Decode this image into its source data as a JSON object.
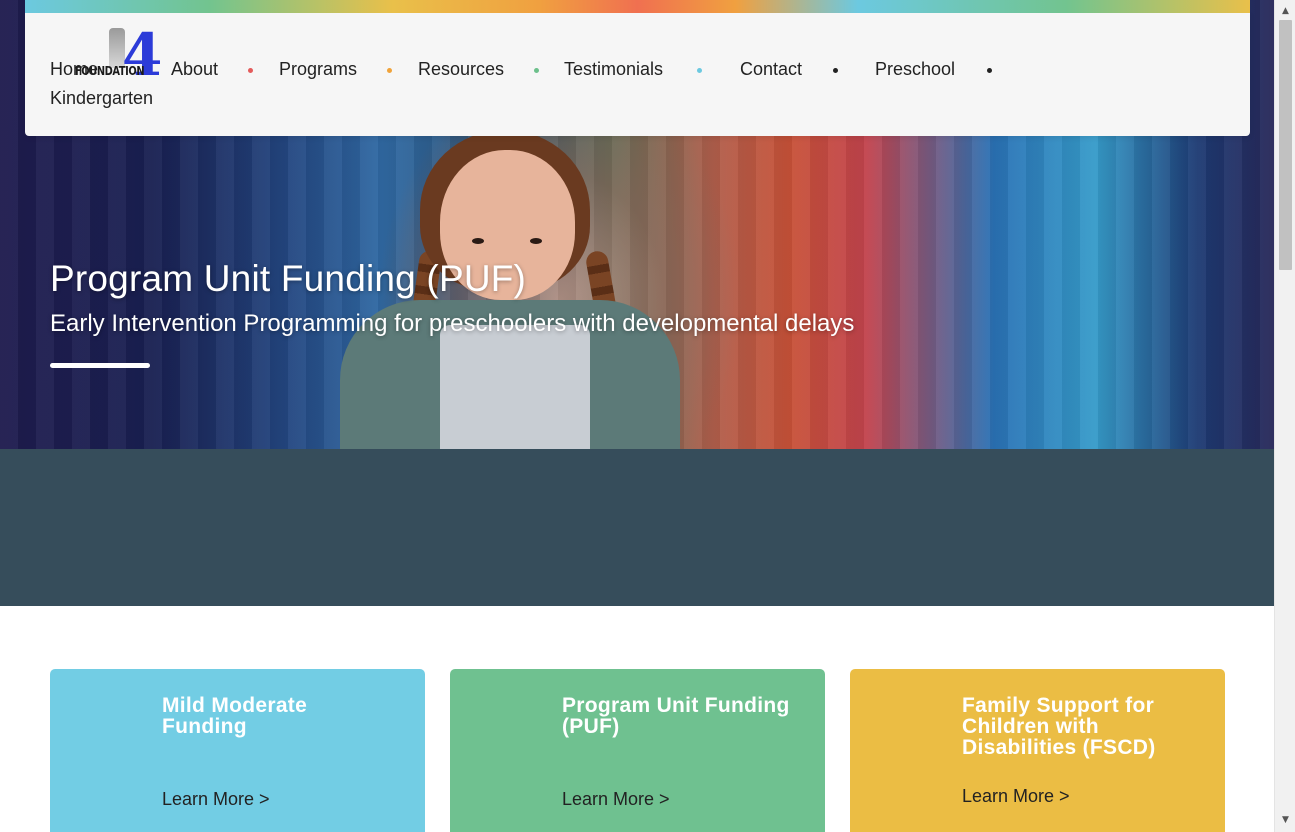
{
  "logo": {
    "number": "4",
    "word": "FOUNDATION"
  },
  "nav": {
    "items": [
      {
        "label": "Home"
      },
      {
        "label": "About"
      },
      {
        "label": "Programs"
      },
      {
        "label": "Resources"
      },
      {
        "label": "Testimonials"
      },
      {
        "label": "Contact"
      },
      {
        "label": "Preschool"
      },
      {
        "label": "Kindergarten"
      }
    ],
    "dot_colors": [
      "#e45b5b",
      "#f0a33a",
      "#6cc08b",
      "#6cc9e0",
      "#222222",
      "#222222"
    ]
  },
  "hero": {
    "title": "Program Unit Funding (PUF)",
    "subtitle": "Early Intervention Programming for preschoolers with developmental delays"
  },
  "band_color": "#364d5b",
  "cards": [
    {
      "title": "Mild Moderate Funding",
      "link": "Learn More >",
      "color": "#72cde4"
    },
    {
      "title": "Program Unit Funding (PUF)",
      "link": "Learn More >",
      "color": "#6fc190"
    },
    {
      "title": "Family Support for Children with Disabilities (FSCD)",
      "link": "Learn More >",
      "color": "#ebbd44"
    }
  ],
  "scrollbar": {
    "up_icon": "▲",
    "down_icon": "▼"
  }
}
